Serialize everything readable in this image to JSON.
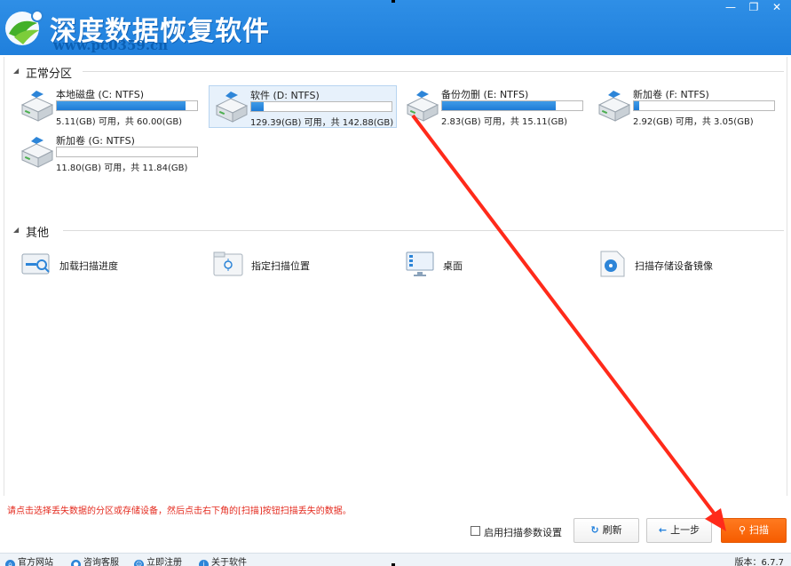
{
  "window": {
    "title": "深度数据恢复软件",
    "watermark": "www.pc0359.cn",
    "controls": [
      "—",
      "❐",
      "✕"
    ]
  },
  "sections": {
    "normal_label": "正常分区",
    "other_label": "其他"
  },
  "drives": [
    {
      "name": "本地磁盘 (C: NTFS)",
      "used_fraction": 0.92,
      "info": "5.11(GB) 可用，共 60.00(GB)",
      "selected": false
    },
    {
      "name": "软件 (D: NTFS)",
      "used_fraction": 0.09,
      "info": "129.39(GB) 可用，共 142.88(GB)",
      "selected": true
    },
    {
      "name": "备份勿删 (E: NTFS)",
      "used_fraction": 0.81,
      "info": "2.83(GB) 可用，共 15.11(GB)",
      "selected": false
    },
    {
      "name": "新加卷 (F: NTFS)",
      "used_fraction": 0.04,
      "info": "2.92(GB) 可用，共 3.05(GB)",
      "selected": false
    },
    {
      "name": "新加卷 (G: NTFS)",
      "used_fraction": 0.0,
      "info": "11.80(GB) 可用，共 11.84(GB)",
      "selected": false
    }
  ],
  "others": [
    {
      "label": "加载扫描进度",
      "icon": "load-progress-icon"
    },
    {
      "label": "指定扫描位置",
      "icon": "folder-target-icon"
    },
    {
      "label": "桌面",
      "icon": "desktop-icon"
    },
    {
      "label": "扫描存储设备镜像",
      "icon": "disk-image-icon"
    }
  ],
  "hint": "请点击选择丢失数据的分区或存储设备，然后点击右下角的[扫描]按钮扫描丢失的数据。",
  "options": {
    "advanced_label": "启用扫描参数设置",
    "advanced_checked": false
  },
  "buttons": {
    "refresh": "刷新",
    "back": "上一步",
    "scan": "扫描"
  },
  "statusbar": {
    "items": [
      "官方网站",
      "咨询客服",
      "立即注册",
      "关于软件"
    ],
    "version": "版本：6.7.7"
  },
  "colors": {
    "titlebar": "#1f7fdc",
    "accent": "#f65c00",
    "hint": "#e42a1e",
    "annotation_arrow": "#ff2a1a"
  }
}
